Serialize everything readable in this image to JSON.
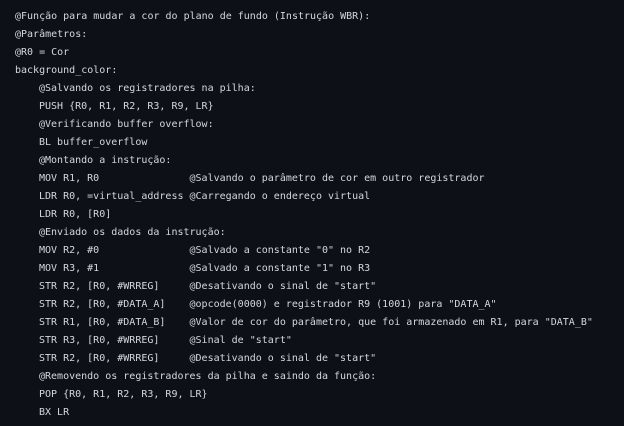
{
  "code": {
    "lines": [
      "@Função para mudar a cor do plano de fundo (Instrução WBR):",
      "@Parâmetros:",
      "@R0 = Cor",
      "background_color:",
      "@Salvando os registradores na pilha:",
      "PUSH {R0, R1, R2, R3, R9, LR}",
      "@Verificando buffer overflow:",
      "BL buffer_overflow",
      "@Montando a instrução:",
      "MOV R1, R0               @Salvando o parâmetro de cor em outro registrador",
      "LDR R0, =virtual_address @Carregando o endereço virtual",
      "LDR R0, [R0]",
      "@Enviado os dados da instrução:",
      "MOV R2, #0               @Salvado a constante \"0\" no R2",
      "MOV R3, #1               @Salvado a constante \"1\" no R3",
      "STR R2, [R0, #WRREG]     @Desativando o sinal de \"start\"",
      "STR R2, [R0, #DATA_A]    @opcode(0000) e registrador R9 (1001) para \"DATA_A\"",
      "STR R1, [R0, #DATA_B]    @Valor de cor do parâmetro, que foi armazenado em R1, para \"DATA_B\"",
      "STR R3, [R0, #WRREG]     @Sinal de \"start\"",
      "STR R2, [R0, #WRREG]     @Desativando o sinal de \"start\"",
      "@Removendo os registradores da pilha e saindo da função:",
      "POP {R0, R1, R2, R3, R9, LR}",
      "BX LR"
    ]
  },
  "colors": {
    "background": "#0d1117",
    "text": "#d2d8de"
  }
}
